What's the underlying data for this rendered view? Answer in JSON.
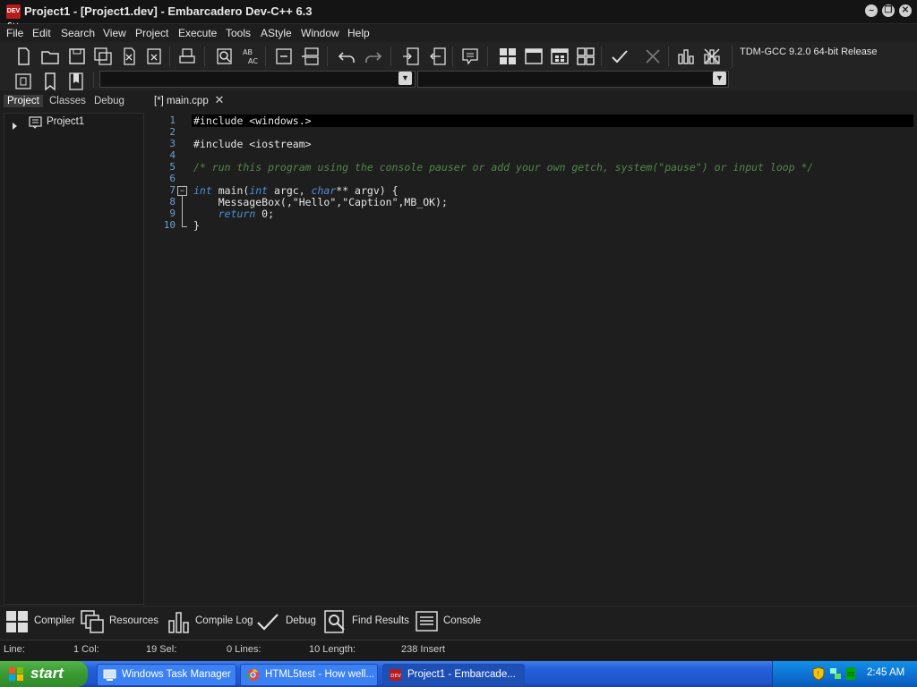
{
  "window": {
    "title": "Project1 - [Project1.dev] - Embarcadero Dev-C++ 6.3",
    "app_icon_text": "DEV C++",
    "minimize": "–",
    "restore": "❐",
    "close": "✕"
  },
  "menu": [
    "File",
    "Edit",
    "Search",
    "View",
    "Project",
    "Execute",
    "Tools",
    "AStyle",
    "Window",
    "Help"
  ],
  "toolbar": {
    "compiler_select": "TDM-GCC 9.2.0 64-bit Release"
  },
  "left_panel": {
    "tabs": [
      "Project",
      "Classes",
      "Debug"
    ],
    "tree_root": "Project1"
  },
  "editor": {
    "tab_label": "[*] main.cpp",
    "tab_close": "✕",
    "fold_marker": "−",
    "lines": [
      {
        "n": "1",
        "parts": [
          {
            "t": "#include <windows.>",
            "c": ""
          }
        ]
      },
      {
        "n": "2",
        "parts": []
      },
      {
        "n": "3",
        "parts": [
          {
            "t": "#include <iostream>",
            "c": ""
          }
        ]
      },
      {
        "n": "4",
        "parts": []
      },
      {
        "n": "5",
        "parts": [
          {
            "t": "/* run this program using the console pauser or add your own getch, system(\"pause\") or input loop */",
            "c": "cm"
          }
        ]
      },
      {
        "n": "6",
        "parts": []
      },
      {
        "n": "7",
        "parts": [
          {
            "t": "int",
            "c": "kw"
          },
          {
            "t": " main(",
            "c": ""
          },
          {
            "t": "int",
            "c": "kw"
          },
          {
            "t": " argc, ",
            "c": ""
          },
          {
            "t": "char",
            "c": "kw"
          },
          {
            "t": "** argv) {",
            "c": ""
          }
        ]
      },
      {
        "n": "8",
        "parts": [
          {
            "t": "    MessageBox(,",
            "c": ""
          },
          {
            "t": "\"Hello\"",
            "c": "str"
          },
          {
            "t": ",",
            "c": ""
          },
          {
            "t": "\"Caption\"",
            "c": "str"
          },
          {
            "t": ",MB_OK);",
            "c": ""
          }
        ]
      },
      {
        "n": "9",
        "parts": [
          {
            "t": "    ",
            "c": ""
          },
          {
            "t": "return",
            "c": "kw"
          },
          {
            "t": " 0;",
            "c": ""
          }
        ]
      },
      {
        "n": "10",
        "parts": [
          {
            "t": "}",
            "c": ""
          }
        ]
      }
    ]
  },
  "bottom_tabs": [
    "Compiler",
    "Resources",
    "Compile Log",
    "Debug",
    "Find Results",
    "Console"
  ],
  "status": {
    "line": "Line:",
    "col": "1 Col:",
    "sel": "19 Sel:",
    "lines": "0 Lines:",
    "length": "10 Length:",
    "insert": "238 Insert"
  },
  "taskbar": {
    "start": "start",
    "tasks": [
      "Windows Task Manager",
      "HTML5test - How well...",
      "Project1 - Embarcade..."
    ],
    "clock": "2:45 AM"
  }
}
